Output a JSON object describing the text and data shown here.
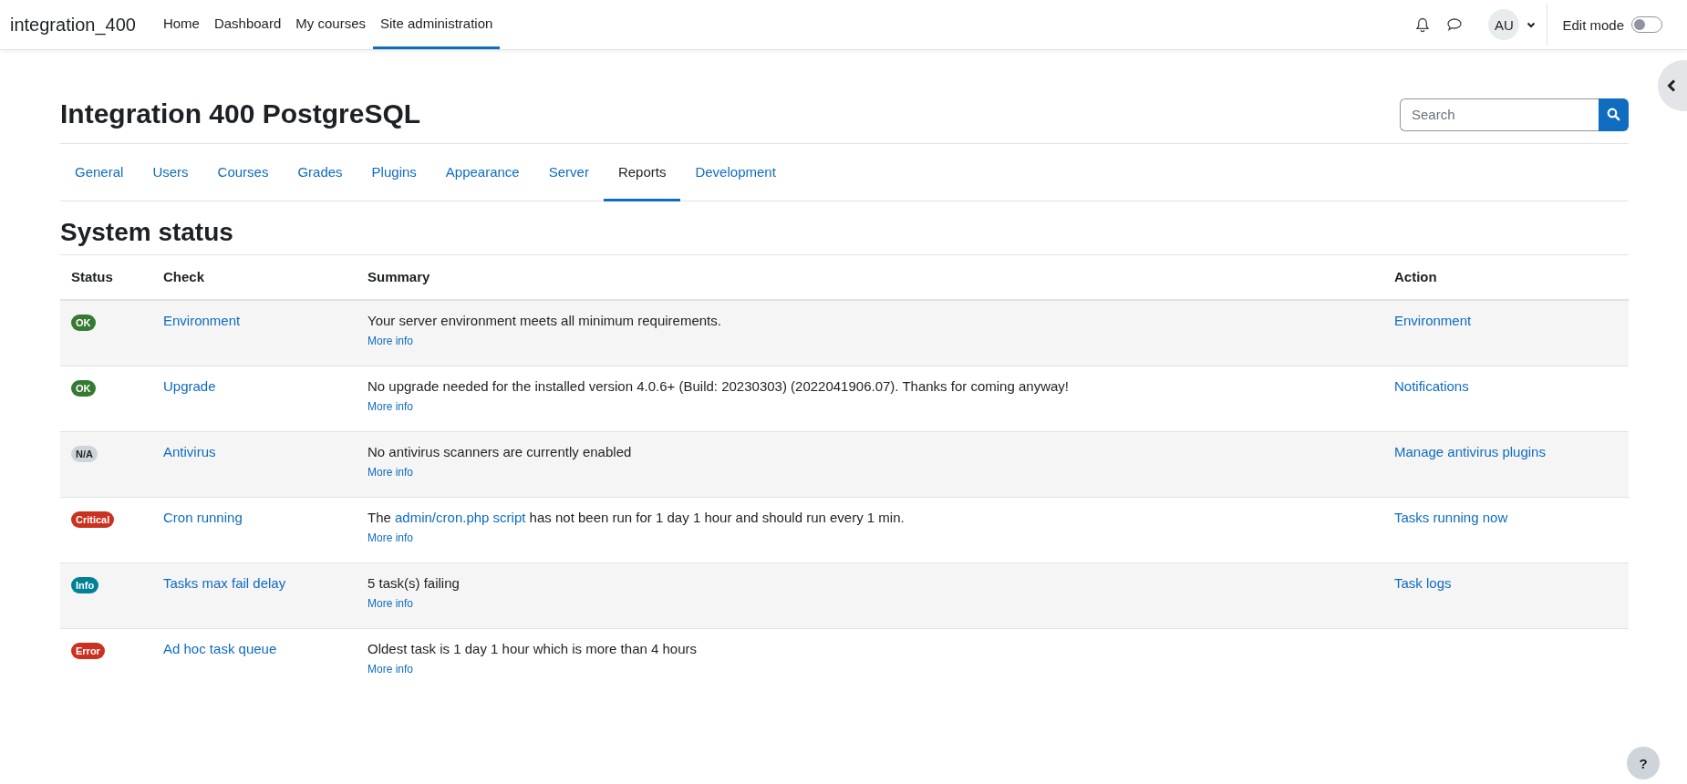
{
  "navbar": {
    "brand": "integration_400",
    "items": [
      {
        "label": "Home",
        "selected": false
      },
      {
        "label": "Dashboard",
        "selected": false
      },
      {
        "label": "My courses",
        "selected": false
      },
      {
        "label": "Site administration",
        "selected": true
      }
    ],
    "avatar": "AU",
    "edit_mode": {
      "label": "Edit mode",
      "on": false
    }
  },
  "header": {
    "title": "Integration 400 PostgreSQL",
    "search": {
      "placeholder": "Search"
    }
  },
  "tabs": [
    {
      "label": "General",
      "selected": false
    },
    {
      "label": "Users",
      "selected": false
    },
    {
      "label": "Courses",
      "selected": false
    },
    {
      "label": "Grades",
      "selected": false
    },
    {
      "label": "Plugins",
      "selected": false
    },
    {
      "label": "Appearance",
      "selected": false
    },
    {
      "label": "Server",
      "selected": false
    },
    {
      "label": "Reports",
      "selected": true
    },
    {
      "label": "Development",
      "selected": false
    }
  ],
  "heading": "System status",
  "table": {
    "columns": [
      "Status",
      "Check",
      "Summary",
      "Action"
    ],
    "rows": [
      {
        "status": {
          "label": "OK",
          "color": "#357a32"
        },
        "check": "Environment",
        "summary": [
          {
            "kind": "text",
            "text": "Your server environment meets all minimum requirements."
          }
        ],
        "more": "More info",
        "action": "Environment"
      },
      {
        "status": {
          "label": "OK",
          "color": "#357a32"
        },
        "check": "Upgrade",
        "summary": [
          {
            "kind": "text",
            "text": "No upgrade needed for the installed version 4.0.6+ (Build: 20230303) (2022041906.07). Thanks for coming anyway!"
          }
        ],
        "more": "More info",
        "action": "Notifications"
      },
      {
        "status": {
          "label": "N/A",
          "color": "#ced4da"
        },
        "check": "Antivirus",
        "summary": [
          {
            "kind": "text",
            "text": "No antivirus scanners are currently enabled"
          }
        ],
        "more": "More info",
        "action": "Manage antivirus plugins"
      },
      {
        "status": {
          "label": "Critical",
          "color": "#ca3120"
        },
        "check": "Cron running",
        "summary": [
          {
            "kind": "text",
            "text": "The "
          },
          {
            "kind": "link",
            "text": "admin/cron.php script"
          },
          {
            "kind": "text",
            "text": " has not been run for 1 day 1 hour and should run every 1 min."
          }
        ],
        "more": "More info",
        "action": "Tasks running now"
      },
      {
        "status": {
          "label": "Info",
          "color": "#008196"
        },
        "check": "Tasks max fail delay",
        "summary": [
          {
            "kind": "text",
            "text": "5 task(s) failing"
          }
        ],
        "more": "More info",
        "action": "Task logs"
      },
      {
        "status": {
          "label": "Error",
          "color": "#ca3120"
        },
        "check": "Ad hoc task queue",
        "summary": [
          {
            "kind": "text",
            "text": "Oldest task is 1 day 1 hour which is more than 4 hours"
          }
        ],
        "more": "More info"
      }
    ]
  },
  "help": "?"
}
